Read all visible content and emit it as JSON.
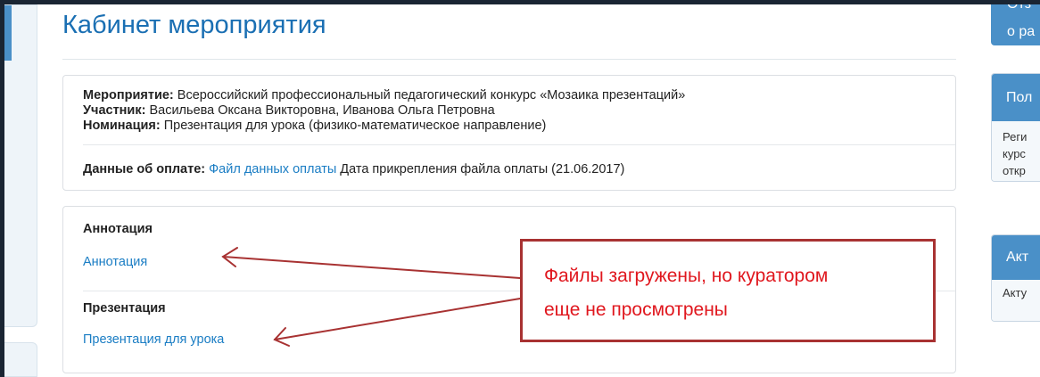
{
  "header": {
    "title": "Кабинет мероприятия"
  },
  "info": {
    "event_label": "Мероприятие:",
    "event_value": "Всероссийский профессиональный педагогический конкурс «Мозаика презентаций»",
    "participant_label": "Участник:",
    "participant_value": "Васильева Оксана Викторовна, Иванова Ольга Петровна",
    "nomination_label": "Номинация:",
    "nomination_value": "Презентация для урока (физико-математическое направление)",
    "payment_label": "Данные об оплате:",
    "payment_link": "Файл данных оплаты",
    "payment_date_text": "Дата прикрепления файла оплаты (21.06.2017)"
  },
  "files": {
    "annotation_heading": "Аннотация",
    "annotation_link": "Аннотация",
    "presentation_heading": "Презентация",
    "presentation_link": "Презентация для урока"
  },
  "callout": {
    "line1": "Файлы загружены, но куратором",
    "line2": "еще не просмотрены"
  },
  "right_sidebar": {
    "top_line1": "Отз",
    "top_line2": "о ра",
    "box1_header": "Пол",
    "box1_lines": [
      "Реги",
      "курс",
      "откр"
    ],
    "box2_header": "Акт",
    "box2_line": "Акту"
  },
  "colors": {
    "accent": "#1a6fb3",
    "link": "#1a7dc4",
    "callout_border": "#a83232",
    "callout_text": "#e0171e",
    "sidebar_header": "#4a90c8"
  }
}
